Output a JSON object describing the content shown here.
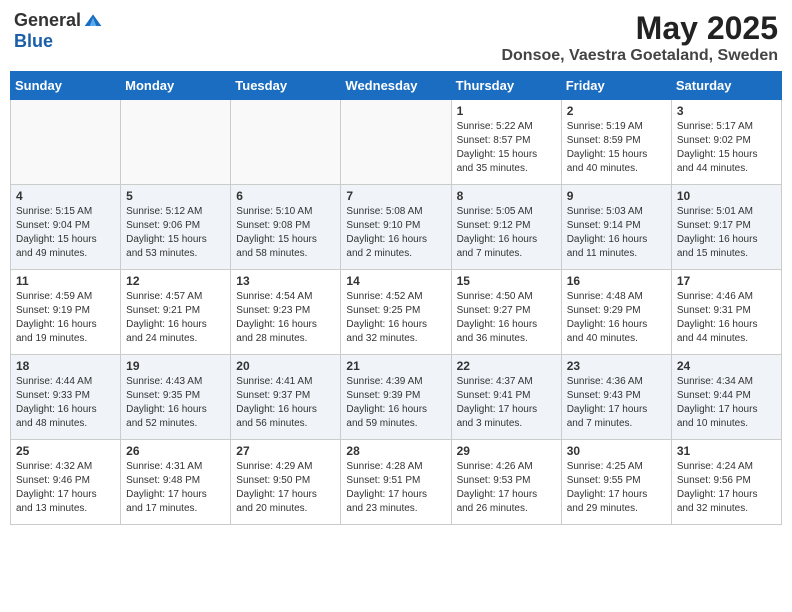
{
  "header": {
    "logo_general": "General",
    "logo_blue": "Blue",
    "month_title": "May 2025",
    "location": "Donsoe, Vaestra Goetaland, Sweden"
  },
  "weekdays": [
    "Sunday",
    "Monday",
    "Tuesday",
    "Wednesday",
    "Thursday",
    "Friday",
    "Saturday"
  ],
  "weeks": [
    [
      {
        "day": "",
        "info": ""
      },
      {
        "day": "",
        "info": ""
      },
      {
        "day": "",
        "info": ""
      },
      {
        "day": "",
        "info": ""
      },
      {
        "day": "1",
        "info": "Sunrise: 5:22 AM\nSunset: 8:57 PM\nDaylight: 15 hours\nand 35 minutes."
      },
      {
        "day": "2",
        "info": "Sunrise: 5:19 AM\nSunset: 8:59 PM\nDaylight: 15 hours\nand 40 minutes."
      },
      {
        "day": "3",
        "info": "Sunrise: 5:17 AM\nSunset: 9:02 PM\nDaylight: 15 hours\nand 44 minutes."
      }
    ],
    [
      {
        "day": "4",
        "info": "Sunrise: 5:15 AM\nSunset: 9:04 PM\nDaylight: 15 hours\nand 49 minutes."
      },
      {
        "day": "5",
        "info": "Sunrise: 5:12 AM\nSunset: 9:06 PM\nDaylight: 15 hours\nand 53 minutes."
      },
      {
        "day": "6",
        "info": "Sunrise: 5:10 AM\nSunset: 9:08 PM\nDaylight: 15 hours\nand 58 minutes."
      },
      {
        "day": "7",
        "info": "Sunrise: 5:08 AM\nSunset: 9:10 PM\nDaylight: 16 hours\nand 2 minutes."
      },
      {
        "day": "8",
        "info": "Sunrise: 5:05 AM\nSunset: 9:12 PM\nDaylight: 16 hours\nand 7 minutes."
      },
      {
        "day": "9",
        "info": "Sunrise: 5:03 AM\nSunset: 9:14 PM\nDaylight: 16 hours\nand 11 minutes."
      },
      {
        "day": "10",
        "info": "Sunrise: 5:01 AM\nSunset: 9:17 PM\nDaylight: 16 hours\nand 15 minutes."
      }
    ],
    [
      {
        "day": "11",
        "info": "Sunrise: 4:59 AM\nSunset: 9:19 PM\nDaylight: 16 hours\nand 19 minutes."
      },
      {
        "day": "12",
        "info": "Sunrise: 4:57 AM\nSunset: 9:21 PM\nDaylight: 16 hours\nand 24 minutes."
      },
      {
        "day": "13",
        "info": "Sunrise: 4:54 AM\nSunset: 9:23 PM\nDaylight: 16 hours\nand 28 minutes."
      },
      {
        "day": "14",
        "info": "Sunrise: 4:52 AM\nSunset: 9:25 PM\nDaylight: 16 hours\nand 32 minutes."
      },
      {
        "day": "15",
        "info": "Sunrise: 4:50 AM\nSunset: 9:27 PM\nDaylight: 16 hours\nand 36 minutes."
      },
      {
        "day": "16",
        "info": "Sunrise: 4:48 AM\nSunset: 9:29 PM\nDaylight: 16 hours\nand 40 minutes."
      },
      {
        "day": "17",
        "info": "Sunrise: 4:46 AM\nSunset: 9:31 PM\nDaylight: 16 hours\nand 44 minutes."
      }
    ],
    [
      {
        "day": "18",
        "info": "Sunrise: 4:44 AM\nSunset: 9:33 PM\nDaylight: 16 hours\nand 48 minutes."
      },
      {
        "day": "19",
        "info": "Sunrise: 4:43 AM\nSunset: 9:35 PM\nDaylight: 16 hours\nand 52 minutes."
      },
      {
        "day": "20",
        "info": "Sunrise: 4:41 AM\nSunset: 9:37 PM\nDaylight: 16 hours\nand 56 minutes."
      },
      {
        "day": "21",
        "info": "Sunrise: 4:39 AM\nSunset: 9:39 PM\nDaylight: 16 hours\nand 59 minutes."
      },
      {
        "day": "22",
        "info": "Sunrise: 4:37 AM\nSunset: 9:41 PM\nDaylight: 17 hours\nand 3 minutes."
      },
      {
        "day": "23",
        "info": "Sunrise: 4:36 AM\nSunset: 9:43 PM\nDaylight: 17 hours\nand 7 minutes."
      },
      {
        "day": "24",
        "info": "Sunrise: 4:34 AM\nSunset: 9:44 PM\nDaylight: 17 hours\nand 10 minutes."
      }
    ],
    [
      {
        "day": "25",
        "info": "Sunrise: 4:32 AM\nSunset: 9:46 PM\nDaylight: 17 hours\nand 13 minutes."
      },
      {
        "day": "26",
        "info": "Sunrise: 4:31 AM\nSunset: 9:48 PM\nDaylight: 17 hours\nand 17 minutes."
      },
      {
        "day": "27",
        "info": "Sunrise: 4:29 AM\nSunset: 9:50 PM\nDaylight: 17 hours\nand 20 minutes."
      },
      {
        "day": "28",
        "info": "Sunrise: 4:28 AM\nSunset: 9:51 PM\nDaylight: 17 hours\nand 23 minutes."
      },
      {
        "day": "29",
        "info": "Sunrise: 4:26 AM\nSunset: 9:53 PM\nDaylight: 17 hours\nand 26 minutes."
      },
      {
        "day": "30",
        "info": "Sunrise: 4:25 AM\nSunset: 9:55 PM\nDaylight: 17 hours\nand 29 minutes."
      },
      {
        "day": "31",
        "info": "Sunrise: 4:24 AM\nSunset: 9:56 PM\nDaylight: 17 hours\nand 32 minutes."
      }
    ]
  ]
}
